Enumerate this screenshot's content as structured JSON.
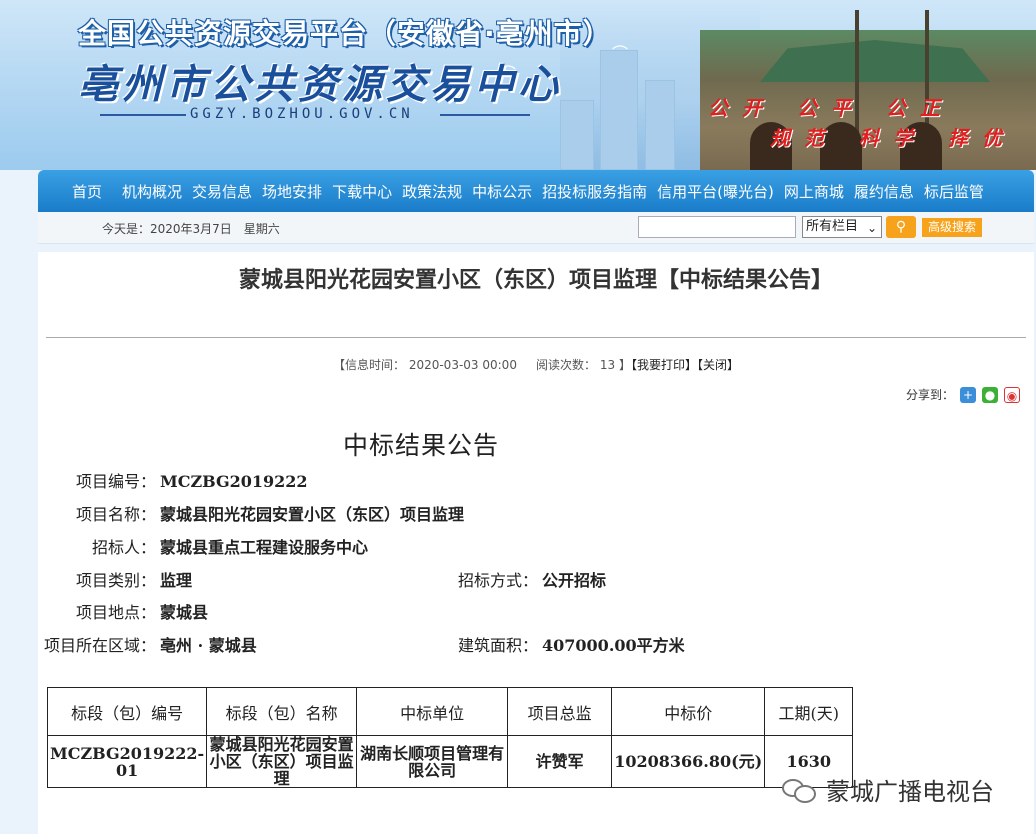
{
  "header": {
    "platform_title": "全国公共资源交易平台（安徽省·亳州市）",
    "site_name": "亳州市公共资源交易中心",
    "domain": "GGZY.BOZHOU.GOV.CN",
    "slogan_line1": "公开 公平 公正",
    "slogan_line2": "规范 科学 择优"
  },
  "nav": {
    "items": [
      "首页",
      "机构概况",
      "交易信息",
      "场地安排",
      "下载中心",
      "政策法规",
      "中标公示",
      "招投标服务指南",
      "信用平台(曝光台)",
      "网上商城",
      "履约信息",
      "标后监管"
    ]
  },
  "subbar": {
    "date_text": "今天是：2020年3月7日　星期六",
    "search_value": "",
    "select_value": "所有栏目",
    "advanced_search_label": "高级搜索"
  },
  "article": {
    "page_title": "蒙城县阳光花园安置小区（东区）项目监理【中标结果公告】",
    "meta_prefix": "【信息时间：",
    "info_time": "2020-03-03 00:00",
    "read_label": "阅读次数：",
    "read_count": "13",
    "meta_mid": "】",
    "print_label": "【我要打印】",
    "close_label": "【关闭】",
    "share_label": "分享到：",
    "announcement_title": "中标结果公告",
    "fields": {
      "project_no_label": "项目编号：",
      "project_no": "MCZBG2019222",
      "project_name_label": "项目名称：",
      "project_name": "蒙城县阳光花园安置小区（东区）项目监理",
      "tenderer_label": "招标人：",
      "tenderer": "蒙城县重点工程建设服务中心",
      "category_label": "项目类别：",
      "category": "监理",
      "method_label": "招标方式：",
      "method": "公开招标",
      "location_label": "项目地点：",
      "location": "蒙城县",
      "region_label": "项目所在区域：",
      "region": "亳州 · 蒙城县",
      "area_label": "建筑面积：",
      "area": "407000.00平方米"
    },
    "table": {
      "headers": [
        "标段（包）编号",
        "标段（包）名称",
        "中标单位",
        "项目总监",
        "中标价",
        "工期(天)"
      ],
      "rows": [
        [
          "MCZBG2019222-01",
          "蒙城县阳光花园安置小区（东区）项目监理",
          "湖南长顺项目管理有限公司",
          "许赞军",
          "10208366.80(元)",
          "1630"
        ]
      ]
    }
  },
  "watermark": {
    "text": "蒙城广播电视台"
  }
}
